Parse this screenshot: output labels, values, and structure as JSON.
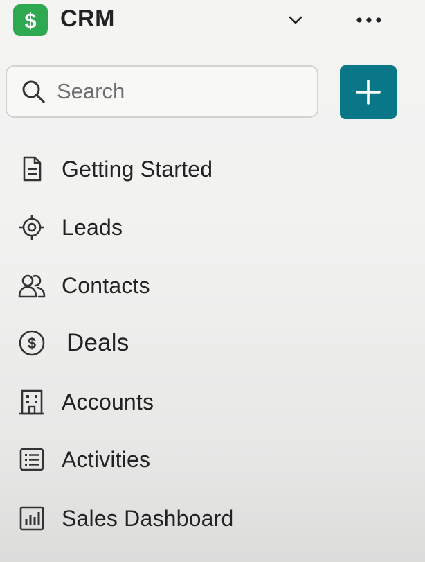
{
  "header": {
    "logo_symbol": "$",
    "title": "CRM",
    "dropdown_icon": "chevron-down-icon",
    "more_icon": "more-horizontal-icon"
  },
  "search": {
    "placeholder": "Search",
    "value": "",
    "icon": "search-icon"
  },
  "add_button": {
    "icon": "plus-icon",
    "color": "#0a7788"
  },
  "brand": {
    "logo_color": "#2fa951"
  },
  "nav": {
    "items": [
      {
        "label": "Getting Started",
        "icon": "document-icon"
      },
      {
        "label": "Leads",
        "icon": "target-icon"
      },
      {
        "label": "Contacts",
        "icon": "users-icon"
      },
      {
        "label": "Deals",
        "icon": "dollar-circle-icon"
      },
      {
        "label": "Accounts",
        "icon": "building-icon"
      },
      {
        "label": "Activities",
        "icon": "list-icon"
      },
      {
        "label": "Sales Dashboard",
        "icon": "bar-chart-icon"
      }
    ]
  }
}
